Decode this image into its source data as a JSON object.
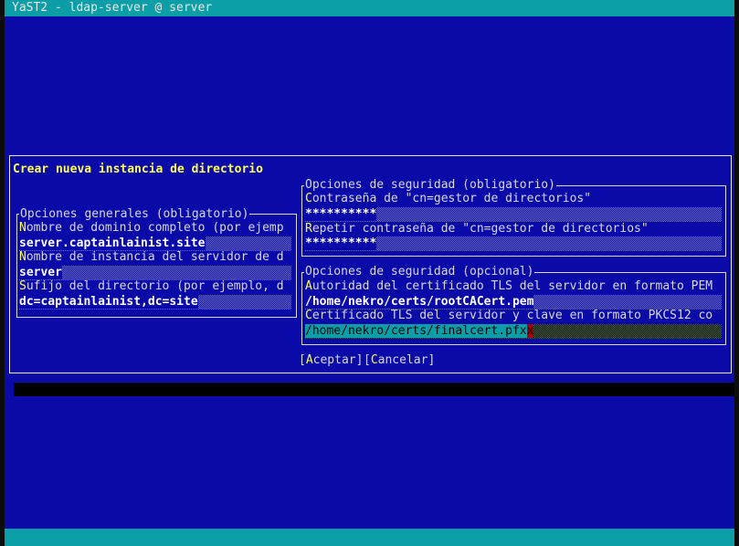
{
  "window": {
    "title": "YaST2 - ldap-server @ server"
  },
  "dialog": {
    "title": "Crear nueva instancia de directorio",
    "general": {
      "legend": "Opciones generales (obligatorio)",
      "domain_label_hot": "N",
      "domain_label_rest": "ombre de dominio completo (por ejemp",
      "domain_value": "server.captainlainist.site",
      "instance_label_hot": "N",
      "instance_label_rest": "ombre de instancia del servidor de d",
      "instance_value": "server",
      "suffix_label_hot": "S",
      "suffix_label_rest": "ufijo del directorio (por ejemplo, d",
      "suffix_value": "dc=captainlainist,dc=site"
    },
    "security_required": {
      "legend": "Opciones de seguridad (obligatorio)",
      "password_label_hot": "C",
      "password_label_rest": "ontraseña de \"cn=gestor de directorios\"",
      "password_value": "**********",
      "repeat_label_hot": "R",
      "repeat_label_rest": "epetir contraseña de \"cn=gestor de directorios\"",
      "repeat_value": "**********"
    },
    "security_optional": {
      "legend": "Opciones de seguridad (opcional)",
      "ca_label_hot": "A",
      "ca_label_rest": "utoridad del certificado TLS del servidor en formato PEM",
      "ca_value": "/home/nekro/certs/rootCACert.pem",
      "cert_label_hot": "C",
      "cert_label_rest": "ertificado TLS del servidor y clave en formato PKCS12 co",
      "cert_value": "/home/nekro/certs/finalcert.pfx",
      "cert_cursor": "x"
    },
    "buttons": {
      "accept_open": "[",
      "accept_hot": "A",
      "accept_rest": "ceptar]",
      "cancel_open": "[",
      "cancel_hot": "C",
      "cancel_rest": "ancelar]"
    }
  }
}
